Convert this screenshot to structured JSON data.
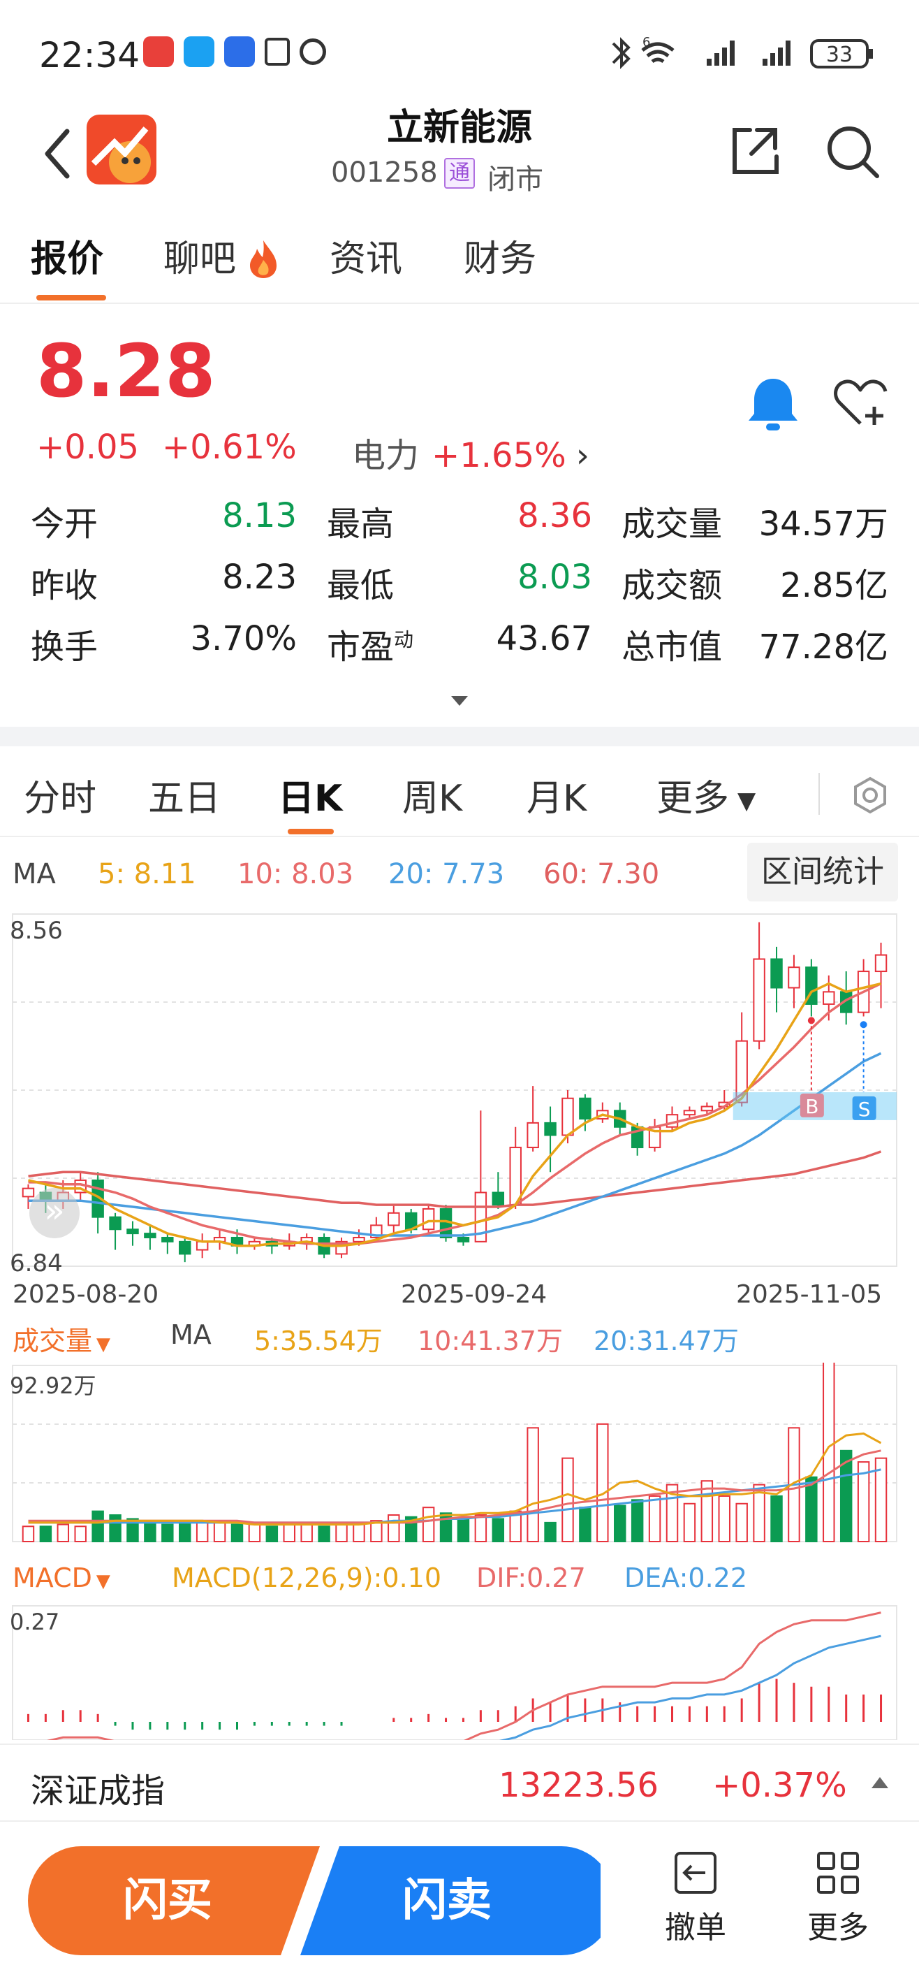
{
  "status_bar": {
    "time": "22:34",
    "battery": "33",
    "network": "6"
  },
  "header": {
    "title": "立新能源",
    "code": "001258",
    "badge": "通",
    "market_status": "闭市",
    "back_icon": "chevron-left-icon",
    "share_icon": "share-icon",
    "search_icon": "search-icon"
  },
  "tabs": [
    {
      "label": "报价"
    },
    {
      "label": "聊吧"
    },
    {
      "label": "资讯"
    },
    {
      "label": "财务"
    }
  ],
  "quote": {
    "price": "8.28",
    "change": "+0.05",
    "change_pct": "+0.61%",
    "sector": "电力",
    "sector_change": "+1.65%",
    "grid": [
      {
        "label": "今开",
        "value": "8.13",
        "color": "green"
      },
      {
        "label": "最高",
        "value": "8.36",
        "color": "red"
      },
      {
        "label": "成交量",
        "value": "34.57万",
        "color": "black"
      },
      {
        "label": "昨收",
        "value": "8.23",
        "color": "black"
      },
      {
        "label": "最低",
        "value": "8.03",
        "color": "green"
      },
      {
        "label": "成交额",
        "value": "2.85亿",
        "color": "black"
      },
      {
        "label": "换手",
        "value": "3.70%",
        "color": "black"
      },
      {
        "label": "市盈",
        "value": "43.67",
        "color": "black",
        "sup": "动"
      },
      {
        "label": "总市值",
        "value": "77.28亿",
        "color": "black"
      }
    ]
  },
  "kline_tabs": [
    {
      "label": "分时"
    },
    {
      "label": "五日"
    },
    {
      "label": "日K"
    },
    {
      "label": "周K"
    },
    {
      "label": "月K"
    },
    {
      "label": "更多"
    }
  ],
  "ma": {
    "label": "MA",
    "items": [
      {
        "text": "5:  8.11",
        "color": "#e8a317"
      },
      {
        "text": "10:  8.03",
        "color": "#e86a6a"
      },
      {
        "text": "20:  7.73",
        "color": "#4a9ee0"
      },
      {
        "text": "60:  7.30",
        "color": "#e06060"
      }
    ],
    "range_btn": "区间统计"
  },
  "chart_data": [
    {
      "type": "candlestick",
      "ylim": [
        6.84,
        8.56
      ],
      "y_labels": [
        "8.56",
        "6.84"
      ],
      "x_labels": [
        "2025-08-20",
        "2025-09-24",
        "2025-11-05"
      ],
      "markers": [
        "B",
        "S"
      ],
      "candles": [
        [
          7.18,
          7.22,
          7.12,
          7.24
        ],
        [
          7.2,
          7.16,
          7.1,
          7.24
        ],
        [
          7.16,
          7.2,
          7.12,
          7.26
        ],
        [
          7.2,
          7.26,
          7.16,
          7.3
        ],
        [
          7.26,
          7.08,
          7.0,
          7.3
        ],
        [
          7.08,
          7.02,
          6.92,
          7.1
        ],
        [
          7.02,
          7.0,
          6.94,
          7.06
        ],
        [
          7.0,
          6.98,
          6.92,
          7.04
        ],
        [
          6.98,
          6.96,
          6.9,
          7.0
        ],
        [
          6.96,
          6.9,
          6.86,
          6.98
        ],
        [
          6.92,
          6.96,
          6.88,
          7.0
        ],
        [
          6.96,
          6.98,
          6.92,
          7.02
        ],
        [
          6.98,
          6.94,
          6.9,
          7.02
        ],
        [
          6.94,
          6.96,
          6.92,
          6.98
        ],
        [
          6.96,
          6.94,
          6.9,
          6.98
        ],
        [
          6.94,
          6.96,
          6.92,
          7.0
        ],
        [
          6.96,
          6.98,
          6.92,
          7.0
        ],
        [
          6.98,
          6.9,
          6.88,
          7.0
        ],
        [
          6.9,
          6.96,
          6.88,
          6.98
        ],
        [
          6.96,
          6.98,
          6.94,
          7.02
        ],
        [
          6.98,
          7.04,
          6.96,
          7.08
        ],
        [
          7.04,
          7.1,
          7.0,
          7.14
        ],
        [
          7.1,
          7.02,
          7.0,
          7.12
        ],
        [
          7.02,
          7.12,
          7.0,
          7.14
        ],
        [
          7.12,
          6.98,
          6.96,
          7.14
        ],
        [
          6.98,
          6.96,
          6.94,
          7.0
        ],
        [
          6.96,
          7.2,
          6.96,
          7.6
        ],
        [
          7.2,
          7.14,
          7.12,
          7.3
        ],
        [
          7.14,
          7.42,
          7.12,
          7.52
        ],
        [
          7.42,
          7.54,
          7.4,
          7.72
        ],
        [
          7.54,
          7.48,
          7.3,
          7.62
        ],
        [
          7.48,
          7.66,
          7.44,
          7.7
        ],
        [
          7.66,
          7.56,
          7.5,
          7.68
        ],
        [
          7.56,
          7.6,
          7.54,
          7.64
        ],
        [
          7.6,
          7.52,
          7.48,
          7.64
        ],
        [
          7.52,
          7.42,
          7.38,
          7.54
        ],
        [
          7.42,
          7.52,
          7.4,
          7.56
        ],
        [
          7.52,
          7.58,
          7.5,
          7.62
        ],
        [
          7.58,
          7.6,
          7.56,
          7.62
        ],
        [
          7.6,
          7.62,
          7.58,
          7.64
        ],
        [
          7.62,
          7.64,
          7.6,
          7.7
        ],
        [
          7.64,
          7.94,
          7.62,
          8.08
        ],
        [
          7.94,
          8.34,
          7.9,
          8.52
        ],
        [
          8.34,
          8.2,
          8.08,
          8.4
        ],
        [
          8.2,
          8.3,
          8.1,
          8.36
        ],
        [
          8.3,
          8.12,
          8.06,
          8.34
        ],
        [
          8.12,
          8.18,
          8.04,
          8.26
        ],
        [
          8.18,
          8.08,
          8.02,
          8.28
        ],
        [
          8.08,
          8.28,
          8.06,
          8.34
        ],
        [
          8.28,
          8.36,
          8.1,
          8.42
        ]
      ],
      "ma5": [
        7.26,
        7.24,
        7.22,
        7.22,
        7.18,
        7.12,
        7.08,
        7.04,
        7.0,
        6.98,
        6.96,
        6.96,
        6.94,
        6.94,
        6.95,
        6.95,
        6.96,
        6.94,
        6.94,
        6.95,
        6.97,
        7.0,
        7.02,
        7.06,
        7.06,
        7.04,
        7.06,
        7.08,
        7.14,
        7.28,
        7.38,
        7.48,
        7.54,
        7.58,
        7.56,
        7.52,
        7.5,
        7.5,
        7.54,
        7.56,
        7.6,
        7.66,
        7.78,
        7.9,
        8.04,
        8.18,
        8.22,
        8.18,
        8.2,
        8.22
      ],
      "ma10": [
        7.25,
        7.25,
        7.24,
        7.24,
        7.22,
        7.2,
        7.17,
        7.13,
        7.1,
        7.07,
        7.04,
        7.02,
        7.0,
        6.98,
        6.97,
        6.96,
        6.95,
        6.95,
        6.95,
        6.95,
        6.96,
        6.97,
        6.98,
        7.0,
        7.02,
        7.04,
        7.06,
        7.09,
        7.14,
        7.2,
        7.27,
        7.33,
        7.39,
        7.44,
        7.48,
        7.5,
        7.52,
        7.54,
        7.56,
        7.58,
        7.62,
        7.68,
        7.75,
        7.83,
        7.91,
        8.0,
        8.08,
        8.14,
        8.18,
        8.22
      ],
      "ma20": [
        7.16,
        7.16,
        7.16,
        7.16,
        7.15,
        7.14,
        7.13,
        7.12,
        7.11,
        7.1,
        7.09,
        7.08,
        7.07,
        7.06,
        7.05,
        7.04,
        7.03,
        7.02,
        7.01,
        7.0,
        6.99,
        6.99,
        6.99,
        6.99,
        6.99,
        6.99,
        7.0,
        7.02,
        7.04,
        7.06,
        7.09,
        7.12,
        7.15,
        7.18,
        7.21,
        7.24,
        7.27,
        7.3,
        7.33,
        7.36,
        7.39,
        7.43,
        7.48,
        7.54,
        7.6,
        7.66,
        7.72,
        7.78,
        7.84,
        7.88
      ],
      "ma60": [
        7.28,
        7.29,
        7.3,
        7.3,
        7.29,
        7.28,
        7.27,
        7.26,
        7.25,
        7.24,
        7.23,
        7.22,
        7.21,
        7.2,
        7.19,
        7.18,
        7.17,
        7.16,
        7.15,
        7.15,
        7.14,
        7.14,
        7.14,
        7.14,
        7.13,
        7.13,
        7.13,
        7.13,
        7.14,
        7.14,
        7.15,
        7.16,
        7.17,
        7.18,
        7.19,
        7.2,
        7.21,
        7.22,
        7.23,
        7.24,
        7.25,
        7.26,
        7.27,
        7.28,
        7.29,
        7.31,
        7.33,
        7.35,
        7.37,
        7.4
      ]
    },
    {
      "type": "bar",
      "title": "成交量",
      "ma_items": [
        {
          "text": "5:35.54万",
          "color": "#e8a317"
        },
        {
          "text": "10:41.37万",
          "color": "#e86a6a"
        },
        {
          "text": "20:31.47万",
          "color": "#4a9ee0"
        }
      ],
      "y_label": "92.92万",
      "ymax": 92.92,
      "values": [
        8,
        8,
        9,
        8,
        16,
        14,
        12,
        10,
        9,
        11,
        10,
        10,
        9,
        9,
        8,
        9,
        9,
        8,
        10,
        9,
        11,
        14,
        13,
        18,
        15,
        12,
        14,
        12,
        16,
        60,
        10,
        44,
        18,
        62,
        19,
        22,
        24,
        30,
        20,
        32,
        24,
        20,
        30,
        24,
        60,
        34,
        100,
        48,
        42,
        44
      ],
      "ma5": [
        10,
        10,
        10,
        10,
        10,
        11,
        11,
        11,
        11,
        11,
        11,
        10,
        10,
        9,
        9,
        9,
        9,
        9,
        9,
        9,
        10,
        10,
        11,
        13,
        14,
        14,
        15,
        15,
        16,
        20,
        22,
        25,
        22,
        25,
        31,
        32,
        28,
        25,
        24,
        24,
        25,
        25,
        26,
        25,
        31,
        35,
        50,
        56,
        57,
        52
      ],
      "ma10": [
        11,
        11,
        11,
        11,
        11,
        11,
        11,
        11,
        11,
        11,
        11,
        11,
        11,
        10,
        10,
        10,
        10,
        10,
        10,
        10,
        10,
        10,
        10,
        11,
        12,
        13,
        13,
        14,
        15,
        16,
        18,
        20,
        21,
        22,
        23,
        24,
        25,
        26,
        27,
        28,
        28,
        27,
        27,
        27,
        28,
        30,
        36,
        42,
        46,
        48
      ],
      "ma20": [
        10,
        10,
        10,
        10,
        10,
        10,
        10,
        10,
        10,
        10,
        10,
        10,
        10,
        10,
        10,
        10,
        10,
        10,
        10,
        10,
        10,
        11,
        11,
        11,
        12,
        12,
        13,
        13,
        14,
        15,
        16,
        17,
        18,
        19,
        20,
        21,
        22,
        23,
        24,
        25,
        26,
        27,
        28,
        29,
        30,
        31,
        33,
        35,
        36,
        38
      ]
    },
    {
      "type": "bar",
      "title": "MACD",
      "params": "MACD(12,26,9):0.10",
      "dif_text": "DIF:0.27",
      "dea_text": "DEA:0.22",
      "y_label": "0.27",
      "values": [
        0.02,
        0.02,
        0.03,
        0.03,
        0.02,
        -0.01,
        -0.02,
        -0.02,
        -0.02,
        -0.02,
        -0.02,
        -0.02,
        -0.02,
        -0.01,
        -0.01,
        -0.01,
        -0.01,
        -0.01,
        -0.01,
        0.0,
        0.0,
        0.01,
        0.01,
        0.02,
        0.01,
        0.01,
        0.03,
        0.03,
        0.04,
        0.06,
        0.05,
        0.07,
        0.06,
        0.06,
        0.05,
        0.04,
        0.04,
        0.04,
        0.04,
        0.04,
        0.04,
        0.06,
        0.1,
        0.11,
        0.1,
        0.09,
        0.09,
        0.07,
        0.07,
        0.07
      ],
      "dif": [
        -0.05,
        -0.05,
        -0.04,
        -0.04,
        -0.04,
        -0.05,
        -0.06,
        -0.07,
        -0.08,
        -0.09,
        -0.1,
        -0.1,
        -0.1,
        -0.1,
        -0.1,
        -0.1,
        -0.1,
        -0.1,
        -0.1,
        -0.09,
        -0.08,
        -0.07,
        -0.06,
        -0.05,
        -0.05,
        -0.05,
        -0.03,
        -0.02,
        0.0,
        0.03,
        0.05,
        0.07,
        0.08,
        0.09,
        0.09,
        0.09,
        0.09,
        0.1,
        0.1,
        0.1,
        0.11,
        0.14,
        0.2,
        0.23,
        0.25,
        0.26,
        0.26,
        0.26,
        0.27,
        0.28
      ],
      "dea": [
        -0.06,
        -0.06,
        -0.06,
        -0.06,
        -0.06,
        -0.06,
        -0.06,
        -0.06,
        -0.07,
        -0.07,
        -0.08,
        -0.08,
        -0.09,
        -0.09,
        -0.09,
        -0.09,
        -0.09,
        -0.09,
        -0.09,
        -0.09,
        -0.09,
        -0.08,
        -0.08,
        -0.07,
        -0.07,
        -0.06,
        -0.05,
        -0.05,
        -0.04,
        -0.02,
        -0.01,
        0.01,
        0.02,
        0.03,
        0.04,
        0.05,
        0.05,
        0.06,
        0.06,
        0.07,
        0.07,
        0.08,
        0.1,
        0.12,
        0.15,
        0.17,
        0.19,
        0.2,
        0.21,
        0.22
      ]
    }
  ],
  "index_bar": {
    "name": "深证成指",
    "value": "13223.56",
    "change": "+0.37%"
  },
  "actions": {
    "buy": "闪买",
    "sell": "闪卖",
    "cancel": "撤单",
    "more": "更多"
  },
  "colors": {
    "up": "#e7323c",
    "down": "#0b9b52",
    "accent": "#f2702a",
    "sell_blue": "#1a7ff5"
  }
}
